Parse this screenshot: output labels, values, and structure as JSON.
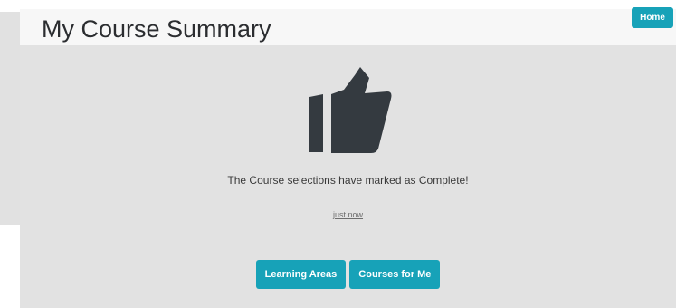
{
  "header": {
    "title": "My Course Summary",
    "home_label": "Home"
  },
  "main": {
    "icon": "thumbs-up-icon",
    "message": "The Course selections have marked as Complete!",
    "timestamp": "just now",
    "buttons": [
      {
        "label": "Learning Areas"
      },
      {
        "label": "Courses for Me"
      }
    ]
  },
  "colors": {
    "accent": "#17a2b8",
    "panel": "#e2e2e2",
    "icon": "#343a40"
  }
}
